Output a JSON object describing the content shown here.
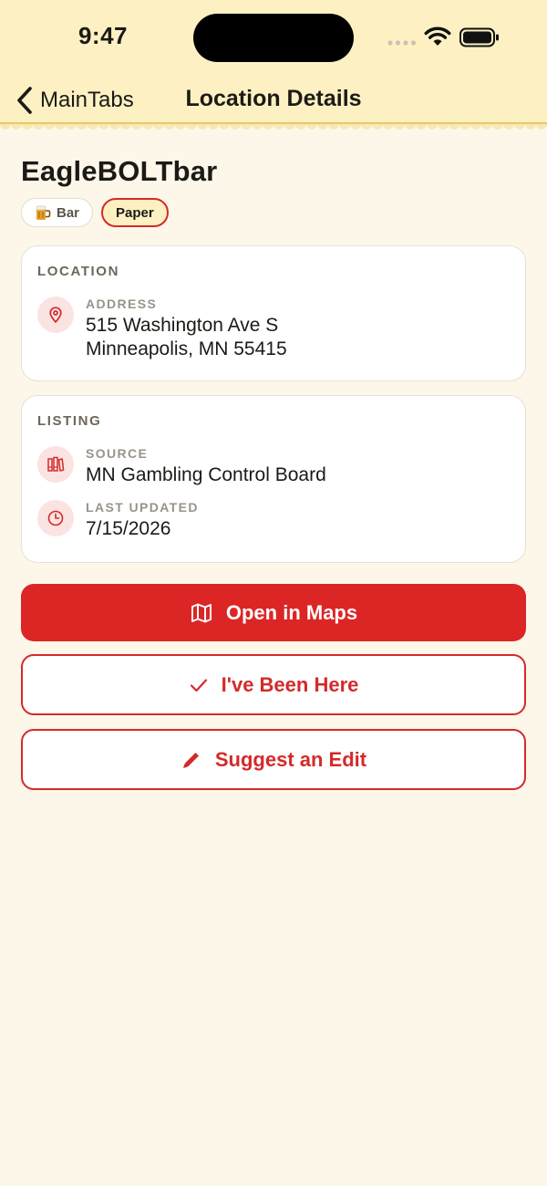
{
  "status_bar": {
    "time": "9:47",
    "icons": [
      "signal-icon",
      "wifi-icon",
      "battery-icon"
    ]
  },
  "nav": {
    "back_label": "MainTabs",
    "title": "Location Details"
  },
  "place": {
    "name": "EagleBOLTbar",
    "chips": [
      {
        "label": "Bar",
        "icon": "beer-mug-icon"
      },
      {
        "label": "Paper"
      }
    ]
  },
  "location_card": {
    "heading": "LOCATION",
    "address_label": "ADDRESS",
    "address_line1": "515 Washington Ave S",
    "address_line2": "Minneapolis, MN 55415"
  },
  "listing_card": {
    "heading": "LISTING",
    "source_label": "SOURCE",
    "source_value": "MN Gambling Control Board",
    "updated_label": "LAST UPDATED",
    "updated_value": "7/15/2026"
  },
  "actions": {
    "open_maps": "Open in Maps",
    "been_here": "I've Been Here",
    "suggest_edit": "Suggest an Edit"
  },
  "colors": {
    "accent": "#dc2626",
    "header_bg": "#fdf1c3",
    "page_bg": "#fcf7e9",
    "icon_bg": "#fbe3e1"
  }
}
